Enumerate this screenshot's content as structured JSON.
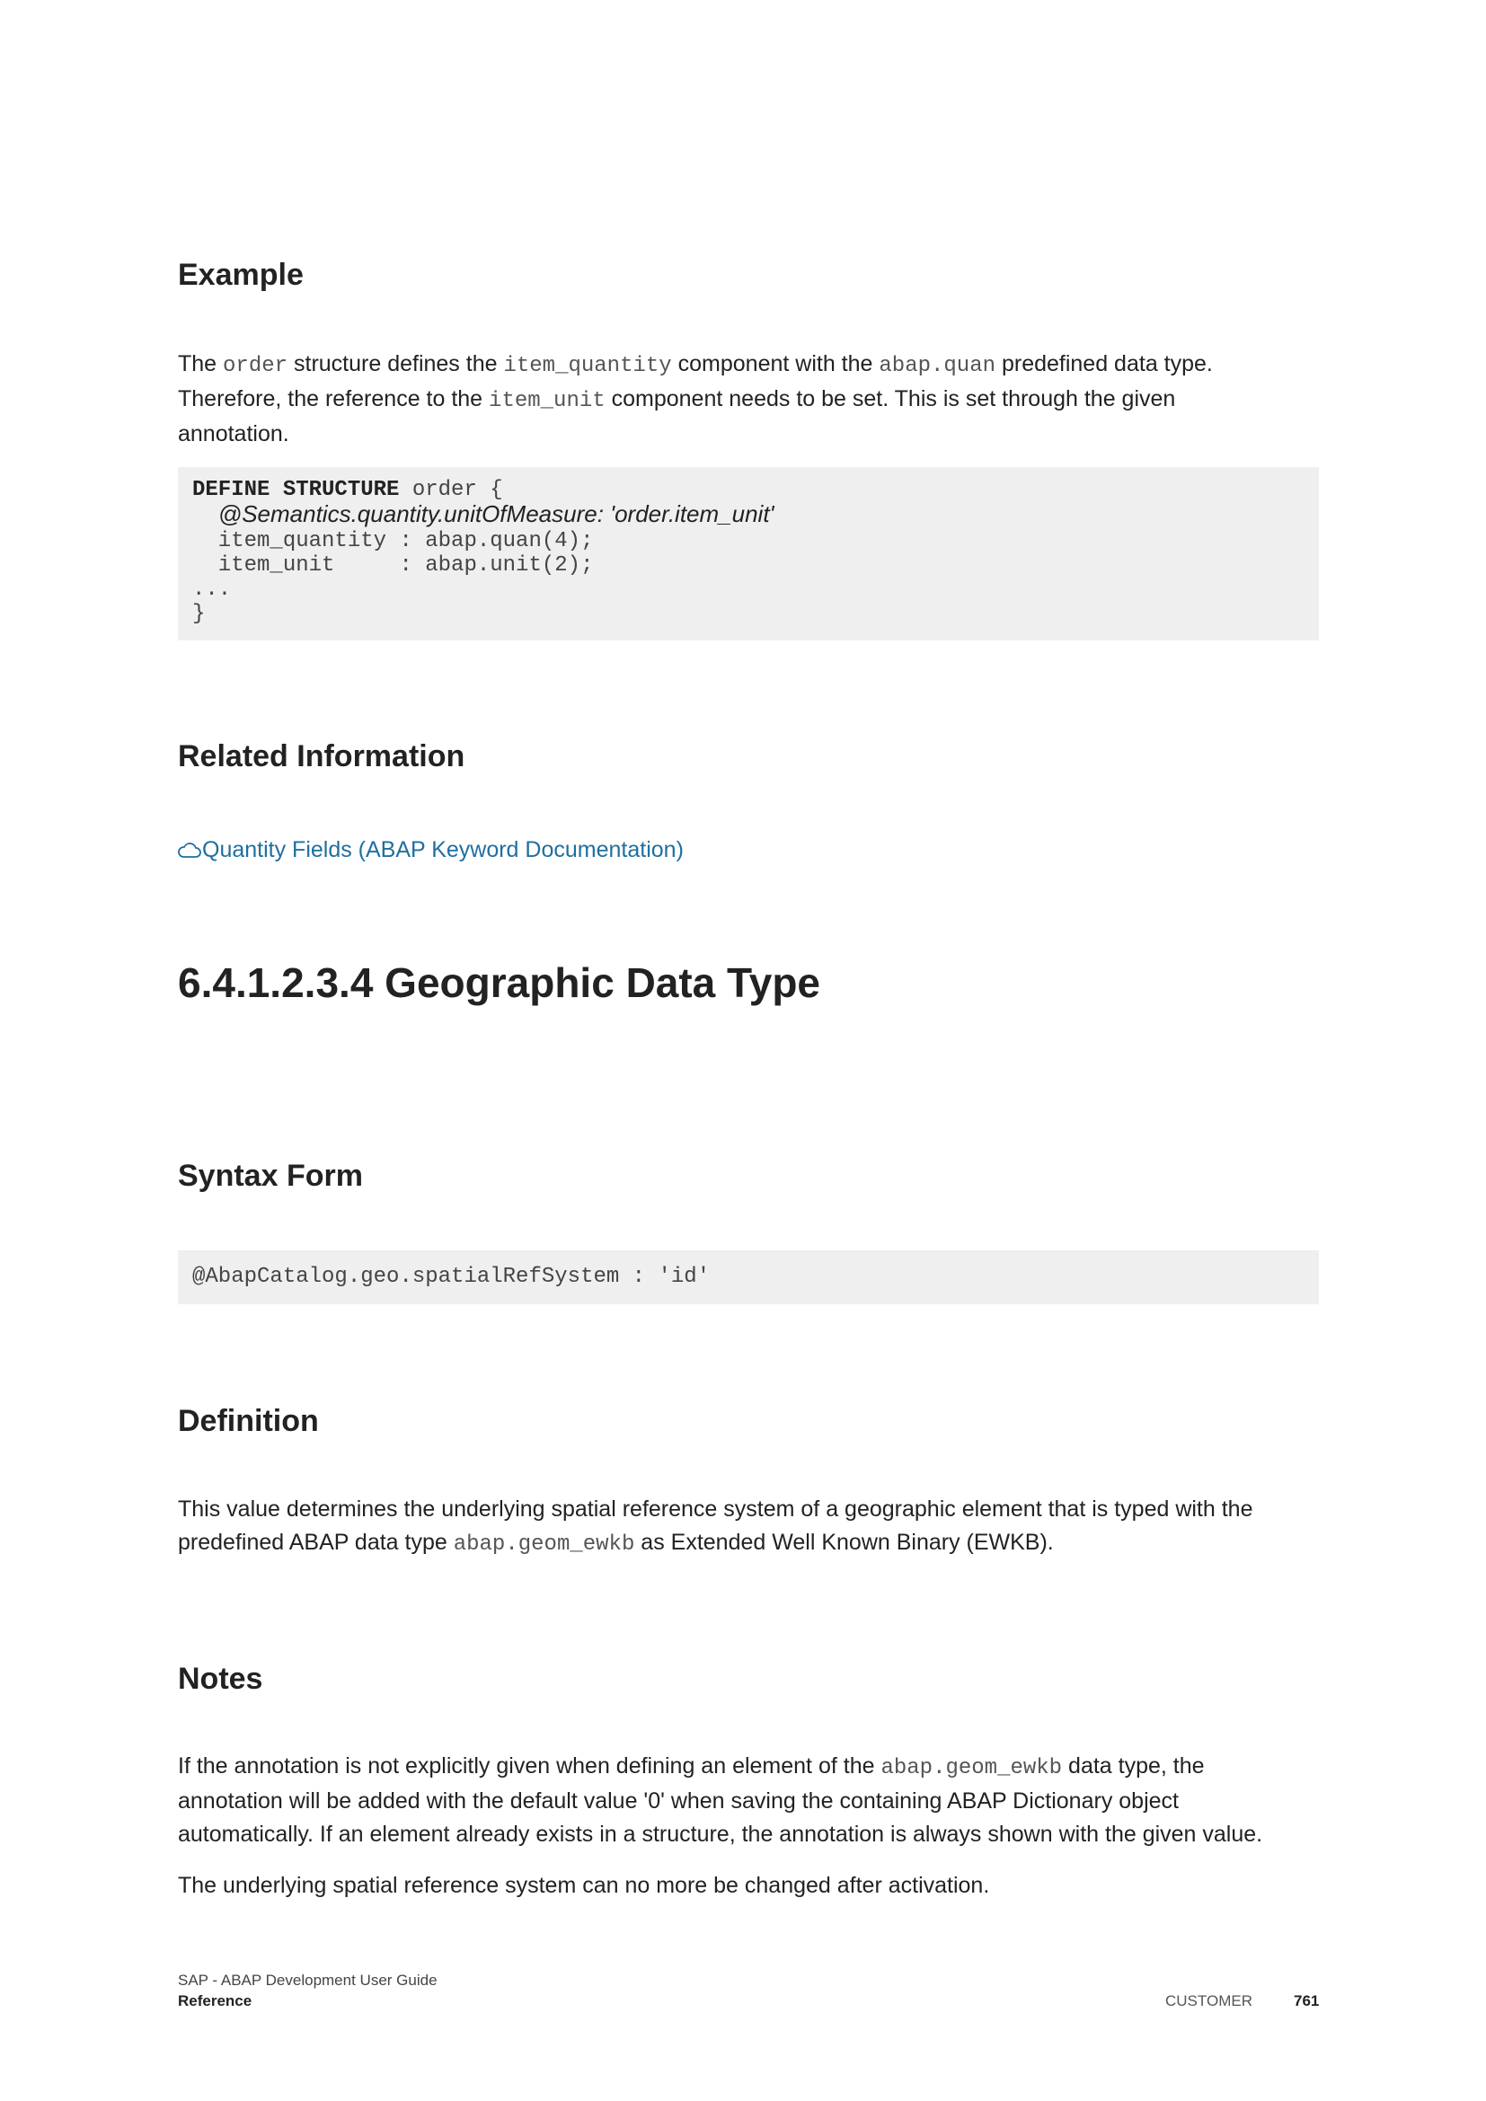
{
  "example": {
    "heading": "Example",
    "para": {
      "t1": "The ",
      "c1": "order",
      "t2": " structure defines the ",
      "c2": "item_quantity",
      "t3": " component with the ",
      "c3": "abap.quan",
      "t4": " predefined data type.",
      "t5": "Therefore, the reference to the ",
      "c4": "item_unit",
      "t6": " component needs to be set. This is set through the given",
      "t7": "annotation."
    },
    "code": {
      "l1_kw": "DEFINE STRUCTURE",
      "l1_rest": " order {",
      "l2_prefix": "  ",
      "l2_anno": "@Semantics.quantity.unitOfMeasure: 'order.item_unit'",
      "l3": "  item_quantity : abap.quan(4);",
      "l4": "  item_unit     : abap.unit(2);",
      "l5": "...",
      "l6": "}"
    }
  },
  "related": {
    "heading": "Related Information",
    "link_label": "Quantity Fields (ABAP Keyword Documentation)",
    "link_icon": "cloud-icon"
  },
  "chapter": {
    "title": "6.4.1.2.3.4  Geographic Data Type"
  },
  "syntax": {
    "heading": "Syntax Form",
    "code": "@AbapCatalog.geo.spatialRefSystem : 'id'"
  },
  "definition": {
    "heading": "Definition",
    "t1": "This value determines the underlying spatial reference system of a geographic element that is typed with the",
    "t2": "predefined ABAP data type ",
    "c1": "abap.geom_ewkb",
    "t3": " as Extended Well Known Binary (EWKB)."
  },
  "notes": {
    "heading": "Notes",
    "p1_t1": "If the annotation is not explicitly given when defining an element of the ",
    "p1_c1": "abap.geom_ewkb",
    "p1_t2": " data type, the",
    "p1_t3": "annotation will be added with the default value '0' when saving the containing ABAP Dictionary object",
    "p1_t4": "automatically. If an element already exists in a structure, the annotation is always shown with the given value.",
    "p2": "The underlying spatial reference system can no more be changed after activation."
  },
  "footer": {
    "doc_title": "SAP - ABAP Development User Guide",
    "section": "Reference",
    "classification": "CUSTOMER",
    "page_number": "761"
  }
}
